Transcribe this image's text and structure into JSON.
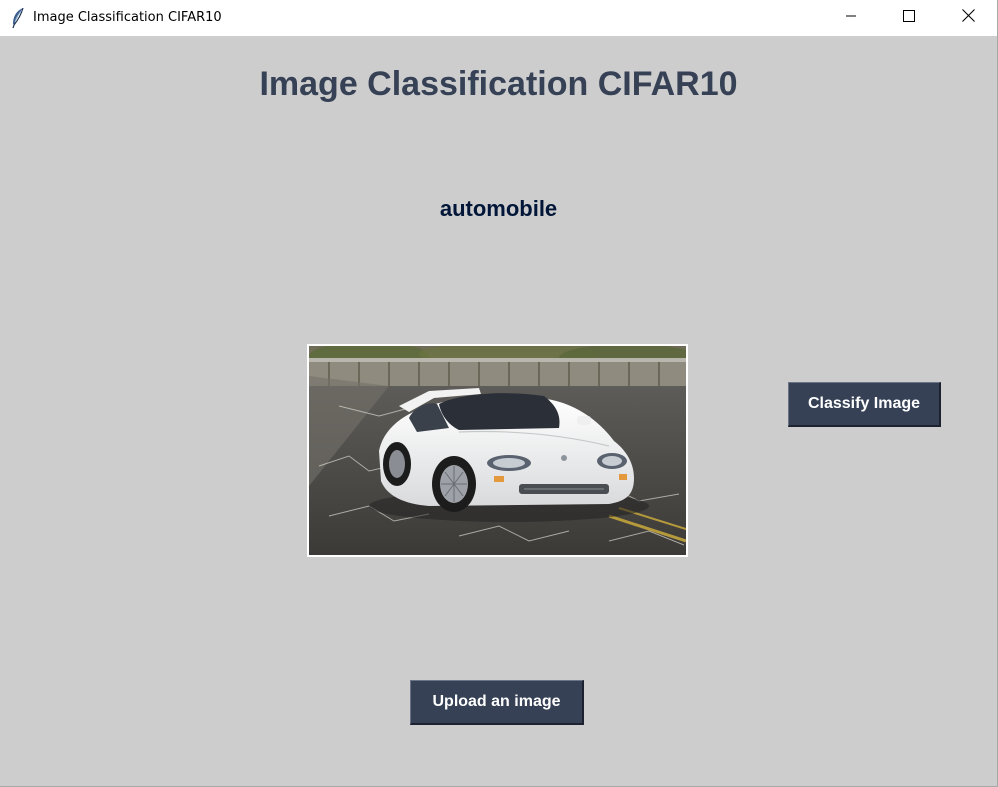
{
  "window": {
    "title": "Image Classification CIFAR10",
    "icon": "feather-icon",
    "controls": [
      "minimize-icon",
      "maximize-icon",
      "close-icon"
    ]
  },
  "main": {
    "heading": "Image Classification CIFAR10",
    "prediction": "automobile",
    "image": {
      "subject": "white sports car on road",
      "icon": "uploaded-image"
    },
    "classify_button": "Classify Image",
    "upload_button": "Upload an image"
  },
  "colors": {
    "background": "#cdcdcd",
    "heading": "#364156",
    "prediction": "#011638",
    "button_bg": "#364156",
    "button_text": "#ffffff"
  }
}
